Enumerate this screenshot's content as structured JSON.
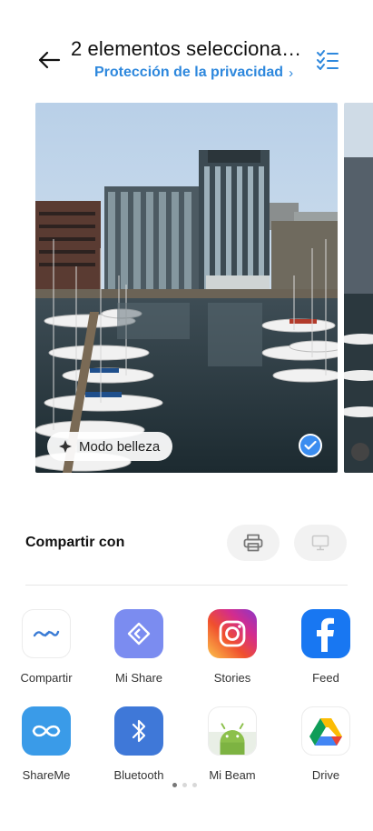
{
  "header": {
    "title": "2 elementos seleccionad…",
    "subtitle": "Protección de la privacidad",
    "subtitle_chevron": "›"
  },
  "photos": {
    "beauty_chip_label": "Modo belleza",
    "selected": true
  },
  "share": {
    "title": "Compartir con",
    "apps": [
      {
        "label": "Compartir",
        "icon": "compartir-icon"
      },
      {
        "label": "Mi Share",
        "icon": "mi-share-icon"
      },
      {
        "label": "Stories",
        "icon": "instagram-icon"
      },
      {
        "label": "Feed",
        "icon": "facebook-icon"
      },
      {
        "label": "ShareMe",
        "icon": "shareme-icon"
      },
      {
        "label": "Bluetooth",
        "icon": "bluetooth-icon"
      },
      {
        "label": "Mi Beam",
        "icon": "android-icon"
      },
      {
        "label": "Drive",
        "icon": "drive-icon"
      }
    ],
    "page_dots": {
      "total": 3,
      "active": 1
    }
  },
  "colors": {
    "accent": "#2e88dd",
    "check_badge": "#3b8df0",
    "facebook": "#1877f2",
    "mi_share": "#7b8cf0",
    "shareme": "#3a9be8",
    "bluetooth": "#3f78d8"
  }
}
